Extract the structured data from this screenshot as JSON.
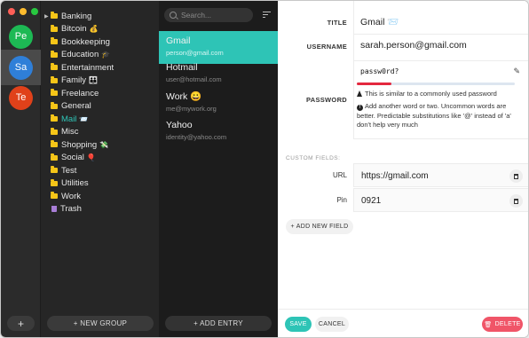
{
  "colors": {
    "accent": "#2ec4b6",
    "danger": "#f05568",
    "strength_bar": "#e4283e"
  },
  "window": {
    "traffic_lights": [
      "#ff5f57",
      "#febc2e",
      "#28c840"
    ]
  },
  "accounts": {
    "items": [
      {
        "initials": "Pe",
        "color": "#1db954"
      },
      {
        "initials": "Sa",
        "color": "#2f7fd8"
      },
      {
        "initials": "Te",
        "color": "#e0411a"
      }
    ],
    "add_label": "+"
  },
  "groups": {
    "items": [
      {
        "label": "Banking",
        "icon": "folder-icon",
        "emoji": ""
      },
      {
        "label": "Bitcoin",
        "icon": "folder-icon",
        "emoji": "💰"
      },
      {
        "label": "Bookkeeping",
        "icon": "folder-icon",
        "emoji": ""
      },
      {
        "label": "Education",
        "icon": "folder-icon",
        "emoji": "🎓"
      },
      {
        "label": "Entertainment",
        "icon": "folder-icon",
        "emoji": ""
      },
      {
        "label": "Family",
        "icon": "folder-icon",
        "emoji": "👪"
      },
      {
        "label": "Freelance",
        "icon": "folder-icon",
        "emoji": ""
      },
      {
        "label": "General",
        "icon": "folder-icon",
        "emoji": ""
      },
      {
        "label": "Mail",
        "icon": "folder-icon",
        "emoji": "📨"
      },
      {
        "label": "Misc",
        "icon": "folder-icon",
        "emoji": ""
      },
      {
        "label": "Shopping",
        "icon": "folder-icon",
        "emoji": "💸"
      },
      {
        "label": "Social",
        "icon": "folder-icon",
        "emoji": "🎈"
      },
      {
        "label": "Test",
        "icon": "folder-icon",
        "emoji": ""
      },
      {
        "label": "Utilities",
        "icon": "folder-icon",
        "emoji": ""
      },
      {
        "label": "Work",
        "icon": "folder-icon",
        "emoji": ""
      },
      {
        "label": "Trash",
        "icon": "trash-icon",
        "emoji": ""
      }
    ],
    "new_group_label": "+ NEW GROUP"
  },
  "entries": {
    "search_placeholder": "Search...",
    "items": [
      {
        "title": "Gmail",
        "subtitle": "person@gmail.com"
      },
      {
        "title": "Hotmail",
        "subtitle": "user@hotmail.com"
      },
      {
        "title": "Work 😀",
        "subtitle": "me@mywork.org"
      },
      {
        "title": "Yahoo",
        "subtitle": "identity@yahoo.com"
      }
    ],
    "add_entry_label": "+ ADD ENTRY"
  },
  "detail": {
    "title_label": "TITLE",
    "title_value": "Gmail 📨",
    "username_label": "USERNAME",
    "username_value": "sarah.person@gmail.com",
    "password_label": "PASSWORD",
    "password_value": "passw0rd?",
    "password_strength": 0.22,
    "password_warning": "This is similar to a commonly used password",
    "password_suggestion": "Add another word or two. Uncommon words are better. Predictable substitutions like '@' instead of 'a' don't help very much",
    "custom_fields_label": "CUSTOM FIELDS:",
    "custom_fields": [
      {
        "key": "URL",
        "value": "https://gmail.com"
      },
      {
        "key": "Pin",
        "value": "0921"
      }
    ],
    "add_field_label": "+ ADD NEW FIELD",
    "save_label": "SAVE",
    "cancel_label": "CANCEL",
    "delete_label": "DELETE"
  }
}
